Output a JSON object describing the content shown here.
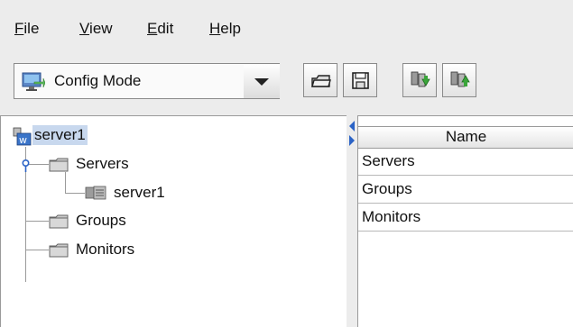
{
  "menu": {
    "file": {
      "mnemonic": "F",
      "rest": "ile"
    },
    "view": {
      "mnemonic": "V",
      "rest": "iew"
    },
    "edit": {
      "mnemonic": "E",
      "rest": "dit"
    },
    "help": {
      "mnemonic": "H",
      "rest": "elp"
    }
  },
  "toolbar": {
    "mode_selected": "Config Mode",
    "icons": [
      "config-mode-icon",
      "open-folder-icon",
      "save-disk-icon",
      "download-servers-icon",
      "upload-servers-icon"
    ]
  },
  "tree": {
    "root": "server1",
    "servers": "Servers",
    "server_child": "server1",
    "groups": "Groups",
    "monitors": "Monitors"
  },
  "table": {
    "header": "Name",
    "rows": [
      "Servers",
      "Groups",
      "Monitors"
    ]
  },
  "colors": {
    "window_bg": "#ececec",
    "selection": "#c8d8ee",
    "accent_blue": "#2b63c6",
    "folder_gray": "#c9c9c9"
  }
}
